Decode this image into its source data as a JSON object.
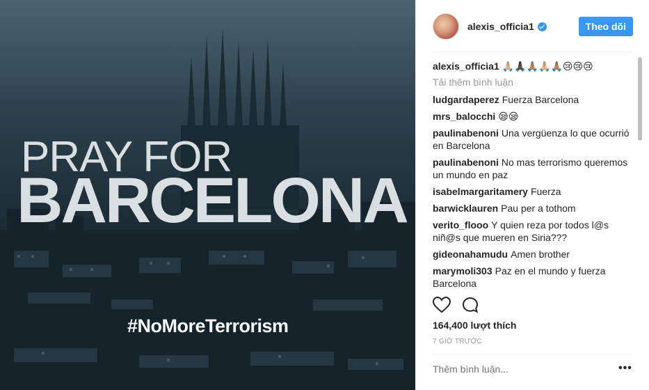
{
  "image": {
    "line1": "PRAY FOR",
    "line2": "BARCELONA",
    "hashtag": "#NoMoreTerrorism"
  },
  "header": {
    "username": "alexis_officia1",
    "follow_label": "Theo dõi"
  },
  "caption": {
    "user": "alexis_officia1",
    "text": "🙏🏼🙏🏿🙏🏽🙏🏼🙏🏽😢😢😢"
  },
  "load_more_label": "Tải thêm bình luận",
  "comments": [
    {
      "user": "ludgardaperez",
      "text": "Fuerza Barcelona"
    },
    {
      "user": "mrs_balocchi",
      "text": "😪😪"
    },
    {
      "user": "paulinabenoni",
      "text": "Una vergüenza lo que ocurrió en Barcelona"
    },
    {
      "user": "paulinabenoni",
      "text": "No mas terrorismo queremos un mundo en paz"
    },
    {
      "user": "isabelmargaritamery",
      "text": "Fuerza"
    },
    {
      "user": "barwicklauren",
      "text": "Pau per a tothom"
    },
    {
      "user": "verito_flooo",
      "text": "Y quien reza por todos l@s niñ@s que mueren en Siria???"
    },
    {
      "user": "gideonahamudu",
      "text": "Amen brother"
    },
    {
      "user": "marymoli303",
      "text": "Paz en el mundo y fuerza Barcelona"
    }
  ],
  "likes": "164,400 lượt thích",
  "time": "7 GIỜ TRƯỚC",
  "add_comment_placeholder": "Thêm bình luận...",
  "more_label": "•••",
  "colors": {
    "accent": "#3897f0",
    "muted": "#999999",
    "text": "#262626"
  }
}
